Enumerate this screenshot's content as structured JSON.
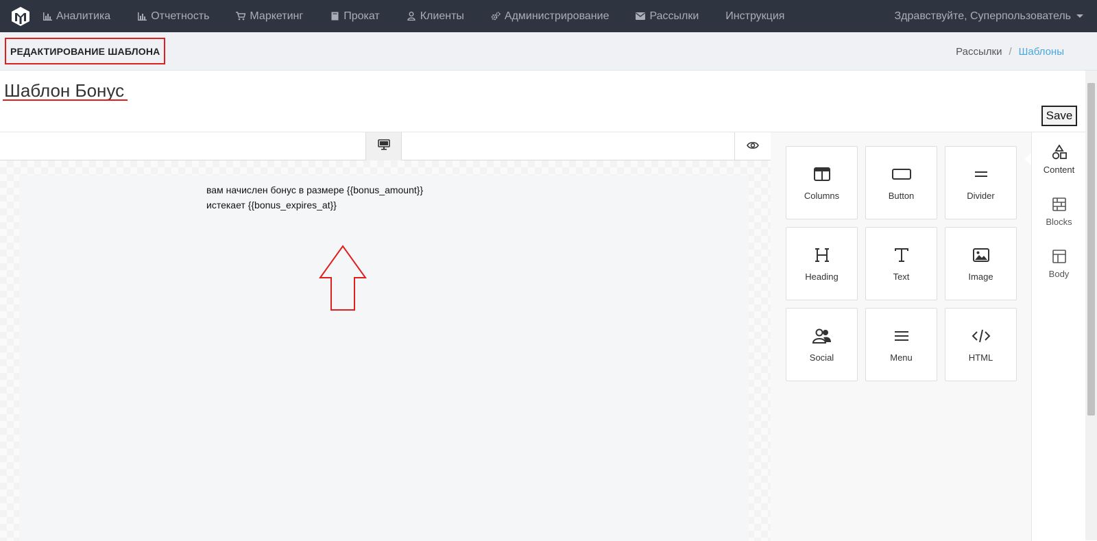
{
  "topnav": {
    "items": [
      {
        "label": "Аналитика",
        "icon": "bar-chart-icon"
      },
      {
        "label": "Отчетность",
        "icon": "bar-chart-icon"
      },
      {
        "label": "Маркетинг",
        "icon": "cart-icon"
      },
      {
        "label": "Прокат",
        "icon": "book-icon"
      },
      {
        "label": "Клиенты",
        "icon": "user-icon"
      },
      {
        "label": "Администрирование",
        "icon": "gears-icon"
      },
      {
        "label": "Рассылки",
        "icon": "envelope-icon"
      },
      {
        "label": "Инструкция",
        "icon": ""
      }
    ],
    "user_greeting": "Здравствуйте, Суперпользователь"
  },
  "subheader": {
    "page_title": "РЕДАКТИРОВАНИЕ ШАБЛОНА",
    "breadcrumb": [
      "Рассылки",
      "Шаблоны"
    ],
    "breadcrumb_separator": "/"
  },
  "template": {
    "name": "Шаблон Бонус",
    "save_label": "Save"
  },
  "canvas": {
    "line1": "вам начислен бонус в размере {{bonus_amount}}",
    "line2": "истекает {{bonus_expires_at}}"
  },
  "tools": [
    {
      "label": "Columns",
      "icon": "columns-icon"
    },
    {
      "label": "Button",
      "icon": "button-icon"
    },
    {
      "label": "Divider",
      "icon": "divider-icon"
    },
    {
      "label": "Heading",
      "icon": "heading-icon"
    },
    {
      "label": "Text",
      "icon": "text-icon"
    },
    {
      "label": "Image",
      "icon": "image-icon"
    },
    {
      "label": "Social",
      "icon": "social-icon"
    },
    {
      "label": "Menu",
      "icon": "menu-icon"
    },
    {
      "label": "HTML",
      "icon": "code-icon"
    }
  ],
  "tabs": [
    {
      "label": "Content",
      "icon": "shapes-icon",
      "active": true
    },
    {
      "label": "Blocks",
      "icon": "blocks-icon",
      "active": false
    },
    {
      "label": "Body",
      "icon": "body-layout-icon",
      "active": false
    }
  ],
  "colors": {
    "nav_bg": "#2f3441",
    "nav_text": "#a9adb7",
    "accent_link": "#4aa7d8",
    "annotation_red": "#e01e1e"
  }
}
